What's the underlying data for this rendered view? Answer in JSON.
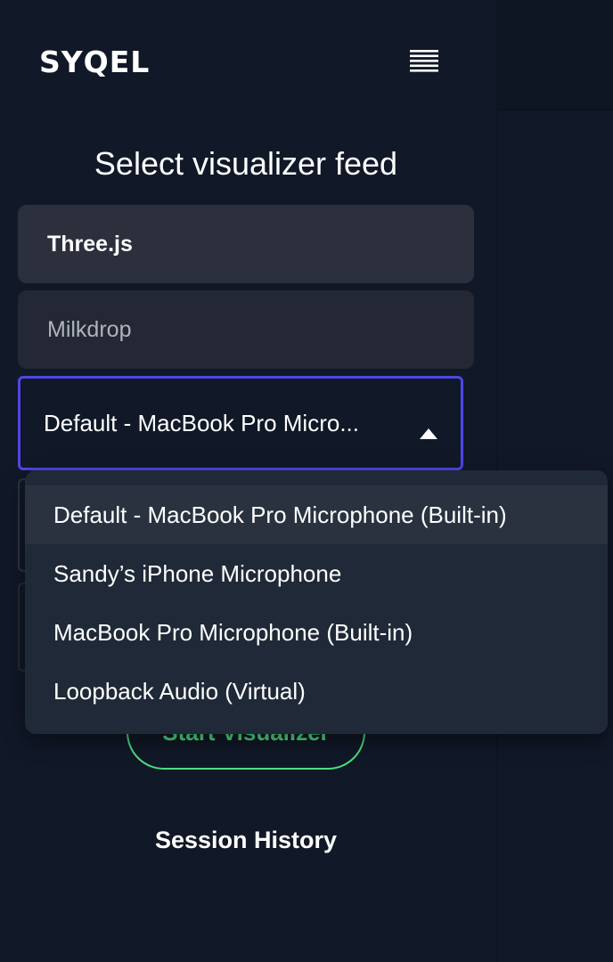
{
  "brand": {
    "logo_text": "SYQEL"
  },
  "header": {
    "menu_icon": "hamburger-menu-icon"
  },
  "feed_selector": {
    "title": "Select visualizer feed",
    "options": [
      {
        "label": "Three.js"
      },
      {
        "label": "Milkdrop"
      }
    ]
  },
  "audio_input": {
    "selected_label": "Default - MacBook Pro Micro...",
    "caret_icon": "caret-up-icon",
    "options": [
      {
        "label": "Default - MacBook Pro Microphone (Built-in)",
        "highlighted": true
      },
      {
        "label": "Sandy’s iPhone Microphone",
        "highlighted": false
      },
      {
        "label": "MacBook Pro Microphone (Built-in)",
        "highlighted": false
      },
      {
        "label": "Loopback Audio (Virtual)",
        "highlighted": false
      }
    ]
  },
  "actions": {
    "start_label": "Start Visualizer"
  },
  "session": {
    "title": "Session History"
  },
  "colors": {
    "background": "#111827",
    "accent_border": "#4f46e5",
    "start_green": "#4ade80",
    "dropdown_bg": "#1f2937",
    "option_bg": "#2a2f3b"
  }
}
